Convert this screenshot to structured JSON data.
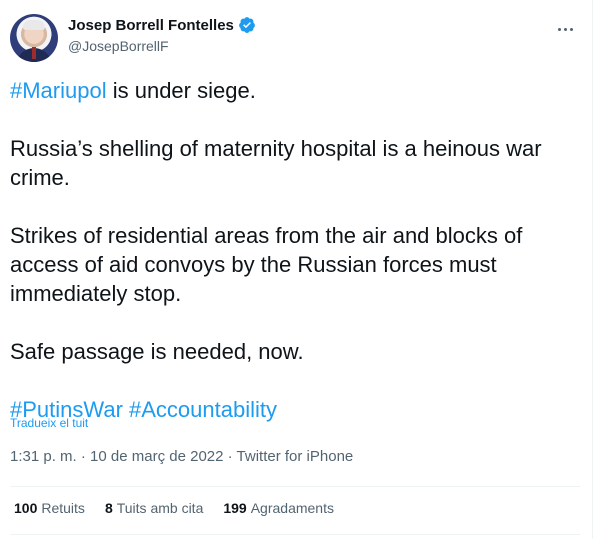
{
  "author": {
    "name": "Josep Borrell Fontelles",
    "handle": "@JosepBorrellF"
  },
  "tweet": {
    "line1_hashtag": "#Mariupol",
    "line1_rest": " is under siege.",
    "para2": "Russia’s shelling of maternity hospital is a heinous war crime.",
    "para3": "Strikes of residential areas from the air and blocks of access of aid convoys by the Russian forces must immediately stop.",
    "para4": "Safe passage is needed, now.",
    "hashtag1": "#PutinsWar",
    "hashtag2": "#Accountability"
  },
  "translate_label": "Tradueix el tuit",
  "meta": {
    "time": "1:31 p. m.",
    "separator": " · ",
    "date": "10 de març de 2022",
    "source": "Twitter for iPhone"
  },
  "stats": {
    "retweets_count": "100",
    "retweets_label": "Retuits",
    "quotes_count": "8",
    "quotes_label": "Tuits amb cita",
    "likes_count": "199",
    "likes_label": "Agradaments"
  },
  "colors": {
    "link": "#1d9bf0",
    "text": "#0f1419",
    "secondary": "#536471",
    "verified": "#1d9bf0"
  }
}
